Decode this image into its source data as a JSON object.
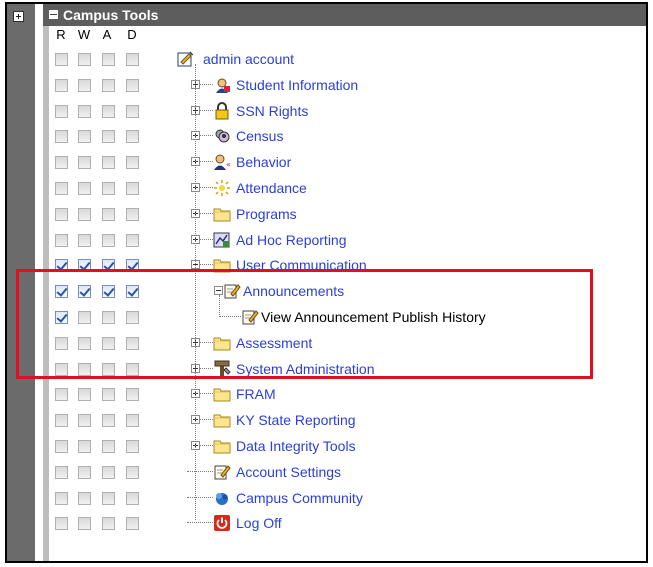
{
  "header": {
    "title": "Campus Tools"
  },
  "columns": [
    "R",
    "W",
    "A",
    "D"
  ],
  "tree": [
    {
      "label": "admin account",
      "icon": "admin-account-icon",
      "checks": [
        false,
        false,
        false,
        false
      ]
    },
    {
      "label": "Student Information",
      "icon": "student-information-icon",
      "checks": [
        false,
        false,
        false,
        false
      ]
    },
    {
      "label": "SSN Rights",
      "icon": "lock-icon",
      "checks": [
        false,
        false,
        false,
        false
      ]
    },
    {
      "label": "Census",
      "icon": "census-icon",
      "checks": [
        false,
        false,
        false,
        false
      ]
    },
    {
      "label": "Behavior",
      "icon": "behavior-icon",
      "checks": [
        false,
        false,
        false,
        false
      ]
    },
    {
      "label": "Attendance",
      "icon": "attendance-icon",
      "checks": [
        false,
        false,
        false,
        false
      ]
    },
    {
      "label": "Programs",
      "icon": "folder-icon",
      "checks": [
        false,
        false,
        false,
        false
      ]
    },
    {
      "label": "Ad Hoc Reporting",
      "icon": "ad-hoc-reporting-icon",
      "checks": [
        false,
        false,
        false,
        false
      ]
    },
    {
      "label": "User Communication",
      "icon": "folder-icon",
      "checks": [
        true,
        true,
        true,
        true
      ]
    },
    {
      "label": "Announcements",
      "icon": "edit-document-icon",
      "checks": [
        true,
        true,
        true,
        true
      ]
    },
    {
      "label": "View Announcement Publish History",
      "icon": "edit-document-icon",
      "checks": [
        true,
        false,
        false,
        false
      ]
    },
    {
      "label": "Assessment",
      "icon": "folder-icon",
      "checks": [
        false,
        false,
        false,
        false
      ]
    },
    {
      "label": "System Administration",
      "icon": "system-administration-icon",
      "checks": [
        false,
        false,
        false,
        false
      ]
    },
    {
      "label": "FRAM",
      "icon": "folder-icon",
      "checks": [
        false,
        false,
        false,
        false
      ]
    },
    {
      "label": "KY State Reporting",
      "icon": "folder-icon",
      "checks": [
        false,
        false,
        false,
        false
      ]
    },
    {
      "label": "Data Integrity Tools",
      "icon": "folder-icon",
      "checks": [
        false,
        false,
        false,
        false
      ]
    },
    {
      "label": "Account Settings",
      "icon": "edit-document-icon",
      "checks": [
        false,
        false,
        false,
        false
      ]
    },
    {
      "label": "Campus Community",
      "icon": "campus-community-icon",
      "checks": [
        false,
        false,
        false,
        false
      ]
    },
    {
      "label": "Log Off",
      "icon": "power-icon",
      "checks": [
        false,
        false,
        false,
        false
      ]
    }
  ]
}
